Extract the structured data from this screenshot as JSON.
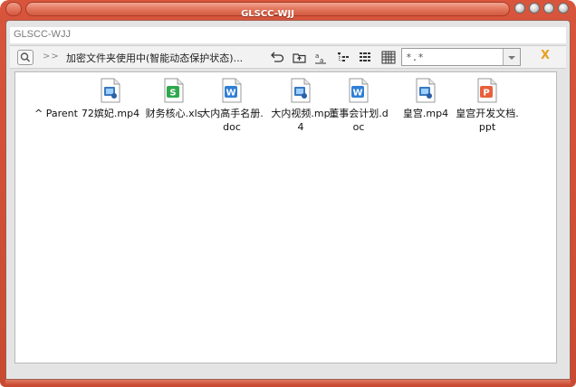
{
  "window": {
    "title": "GLSCC-WJJ",
    "inner_title": "GLSCC-WJJ",
    "colors": {
      "frame": "#d25a40",
      "accent_x": "#e8a020"
    }
  },
  "toolbar": {
    "chevrons": ">>",
    "path": "加密文件夹使用中(智能动态保护状态)...",
    "filter_value": "*.*",
    "close_label": "X",
    "tools": [
      "back-icon",
      "up-folder-icon",
      "sort-az-icon",
      "tree-view-icon",
      "list-view-icon",
      "grid-view-icon"
    ]
  },
  "files": [
    {
      "label": "^ Parent",
      "type": "parent"
    },
    {
      "label": "72嫔妃.mp4",
      "type": "mp4"
    },
    {
      "label": "财务核心.xls",
      "type": "xls"
    },
    {
      "label": "大内高手名册.doc",
      "type": "doc"
    },
    {
      "label": "大内视频.mp4",
      "type": "mp4"
    },
    {
      "label": "董事会计划.doc",
      "type": "doc"
    },
    {
      "label": "皇宫.mp4",
      "type": "mp4"
    },
    {
      "label": "皇宫开发文档.ppt",
      "type": "ppt"
    }
  ]
}
